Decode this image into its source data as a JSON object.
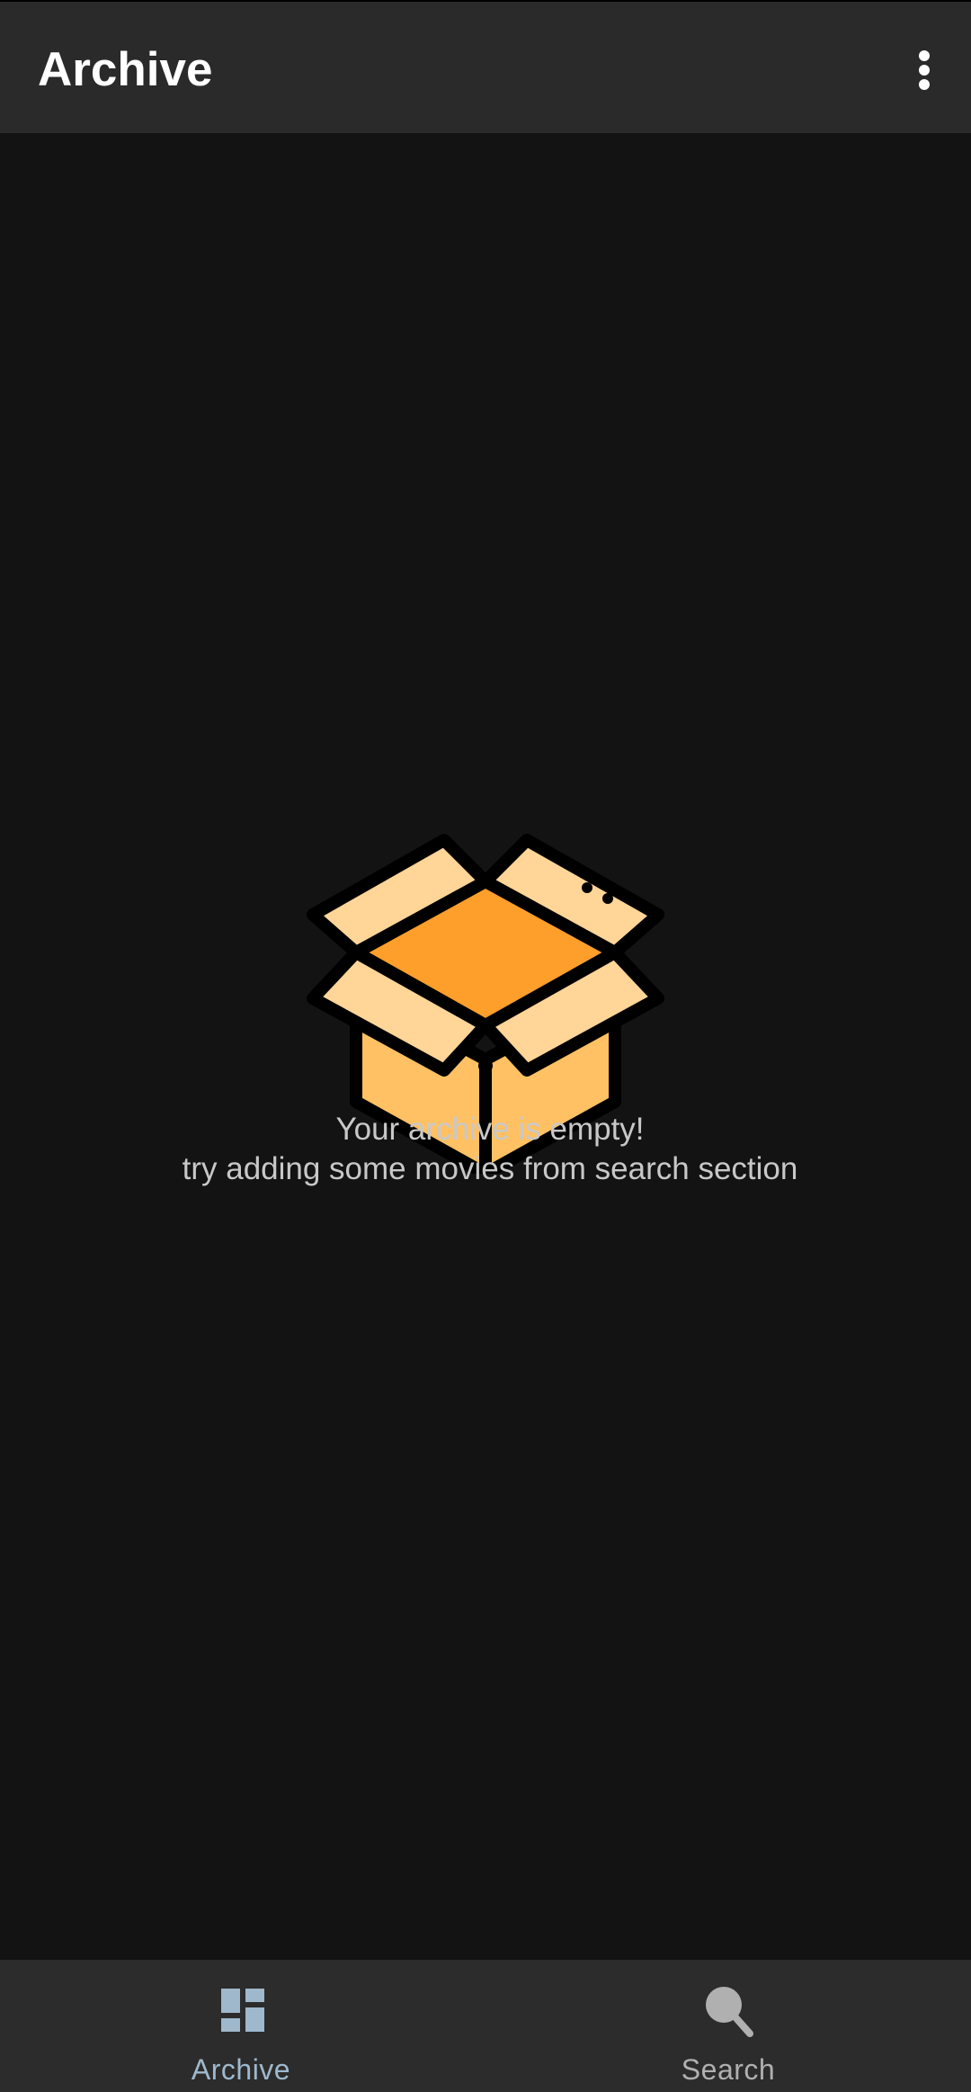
{
  "appbar": {
    "title": "Archive",
    "menu_icon": "more-vert-icon"
  },
  "empty_state": {
    "icon": "open-box-icon",
    "line1": "Your archive is empty!",
    "line2": "try adding some movies from search section"
  },
  "bottom_nav": {
    "items": [
      {
        "label": "Archive",
        "icon": "dashboard-icon",
        "active": true
      },
      {
        "label": "Search",
        "icon": "search-icon",
        "active": false
      }
    ]
  },
  "colors": {
    "background": "#131313",
    "appbar": "#2a2a2a",
    "bottom_nav": "#2c2c2c",
    "active_tab": "#9fb8cc",
    "box_top": "#ffd598",
    "box_inside": "#ff9f2b",
    "box_front": "#ffc163"
  }
}
